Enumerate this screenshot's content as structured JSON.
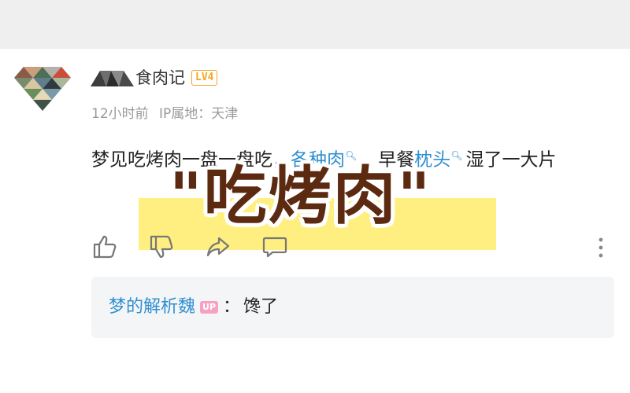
{
  "comment": {
    "username": "食肉记",
    "level": "LV4",
    "time": "12小时前",
    "ip_location": "IP属地：天津",
    "text_before": "梦见吃烤肉一盘一盘吃，",
    "tag1": "各种肉",
    "text_middle": "，早餐",
    "tag2": "枕头",
    "text_after": "湿了一大片"
  },
  "overlay": {
    "title": "\"吃烤肉\""
  },
  "reply": {
    "username": "梦的解析魏",
    "badge": "UP",
    "separator": "：",
    "text": "馋了"
  },
  "colors": {
    "link": "#2f8fd1",
    "level_badge": "#f5a623",
    "up_badge": "#f7a1c1",
    "highlight": "#ffec6b",
    "overlay_text": "#5b2a10"
  },
  "icons": [
    "like-icon",
    "dislike-icon",
    "share-icon",
    "comment-icon",
    "more-icon",
    "search-icon"
  ]
}
